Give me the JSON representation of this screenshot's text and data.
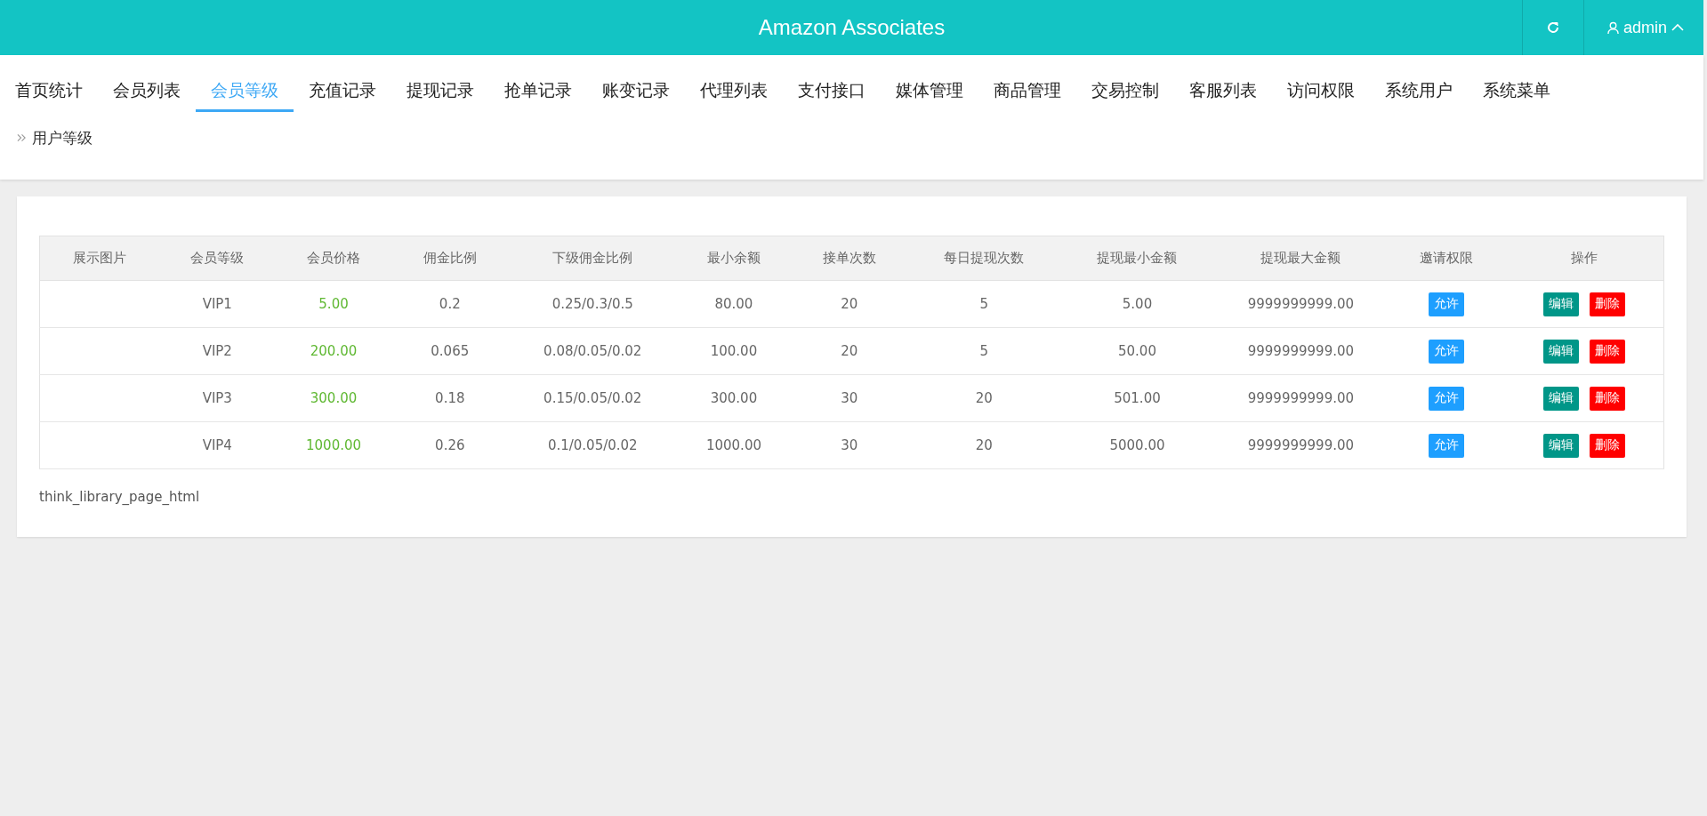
{
  "header": {
    "title": "Amazon Associates",
    "user": "admin"
  },
  "nav": [
    {
      "label": "首页统计",
      "selected": false
    },
    {
      "label": "会员列表",
      "selected": false
    },
    {
      "label": "会员等级",
      "selected": true
    },
    {
      "label": "充值记录",
      "selected": false
    },
    {
      "label": "提现记录",
      "selected": false
    },
    {
      "label": "抢单记录",
      "selected": false
    },
    {
      "label": "账变记录",
      "selected": false
    },
    {
      "label": "代理列表",
      "selected": false
    },
    {
      "label": "支付接口",
      "selected": false
    },
    {
      "label": "媒体管理",
      "selected": false
    },
    {
      "label": "商品管理",
      "selected": false
    },
    {
      "label": "交易控制",
      "selected": false
    },
    {
      "label": "客服列表",
      "selected": false
    },
    {
      "label": "访问权限",
      "selected": false
    },
    {
      "label": "系统用户",
      "selected": false
    },
    {
      "label": "系统菜单",
      "selected": false
    }
  ],
  "breadcrumb": "用户等级",
  "table": {
    "columns": [
      "展示图片",
      "会员等级",
      "会员价格",
      "佣金比例",
      "下级佣金比例",
      "最小余额",
      "接单次数",
      "每日提现次数",
      "提现最小金额",
      "提现最大金额",
      "邀请权限",
      "操作"
    ],
    "rows": [
      {
        "level": "VIP1",
        "price": "5.00",
        "commission": "0.2",
        "sub_commission": "0.25/0.3/0.5",
        "min_balance": "80.00",
        "order_count": "20",
        "daily_withdrawals": "5",
        "min_withdrawal": "5.00",
        "max_withdrawal": "9999999999.00",
        "invite": "允许",
        "edit": "编辑",
        "delete": "删除"
      },
      {
        "level": "VIP2",
        "price": "200.00",
        "commission": "0.065",
        "sub_commission": "0.08/0.05/0.02",
        "min_balance": "100.00",
        "order_count": "20",
        "daily_withdrawals": "5",
        "min_withdrawal": "50.00",
        "max_withdrawal": "9999999999.00",
        "invite": "允许",
        "edit": "编辑",
        "delete": "删除"
      },
      {
        "level": "VIP3",
        "price": "300.00",
        "commission": "0.18",
        "sub_commission": "0.15/0.05/0.02",
        "min_balance": "300.00",
        "order_count": "30",
        "daily_withdrawals": "20",
        "min_withdrawal": "501.00",
        "max_withdrawal": "9999999999.00",
        "invite": "允许",
        "edit": "编辑",
        "delete": "删除"
      },
      {
        "level": "VIP4",
        "price": "1000.00",
        "commission": "0.26",
        "sub_commission": "0.1/0.05/0.02",
        "min_balance": "1000.00",
        "order_count": "30",
        "daily_withdrawals": "20",
        "min_withdrawal": "5000.00",
        "max_withdrawal": "9999999999.00",
        "invite": "允许",
        "edit": "编辑",
        "delete": "删除"
      }
    ]
  },
  "pager_text": "think_library_page_html"
}
